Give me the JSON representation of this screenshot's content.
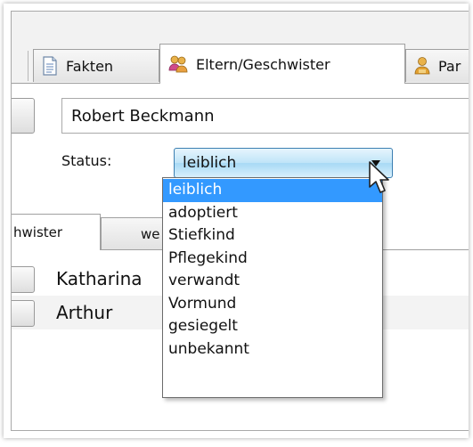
{
  "tabs": [
    {
      "label": "Fakten",
      "icon": "document-icon",
      "active": false
    },
    {
      "label": "Eltern/Geschwister",
      "icon": "people-icon",
      "active": true
    },
    {
      "label": "Par",
      "icon": "person-icon",
      "active": false
    }
  ],
  "person": {
    "name": "Robert Beckmann"
  },
  "status": {
    "label": "Status:",
    "value": "leiblich",
    "options": [
      "leiblich",
      "adoptiert",
      "Stiefkind",
      "Pflegekind",
      "verwandt",
      "Vormund",
      "gesiegelt",
      "unbekannt"
    ],
    "selected_index": 0
  },
  "subtabs": [
    {
      "label": "hwister",
      "active": true
    },
    {
      "label": "we",
      "active": false
    }
  ],
  "siblings": [
    "Katharina",
    "Arthur"
  ],
  "colors": {
    "selection": "#3399ff",
    "combo_border": "#3c7fb1"
  }
}
